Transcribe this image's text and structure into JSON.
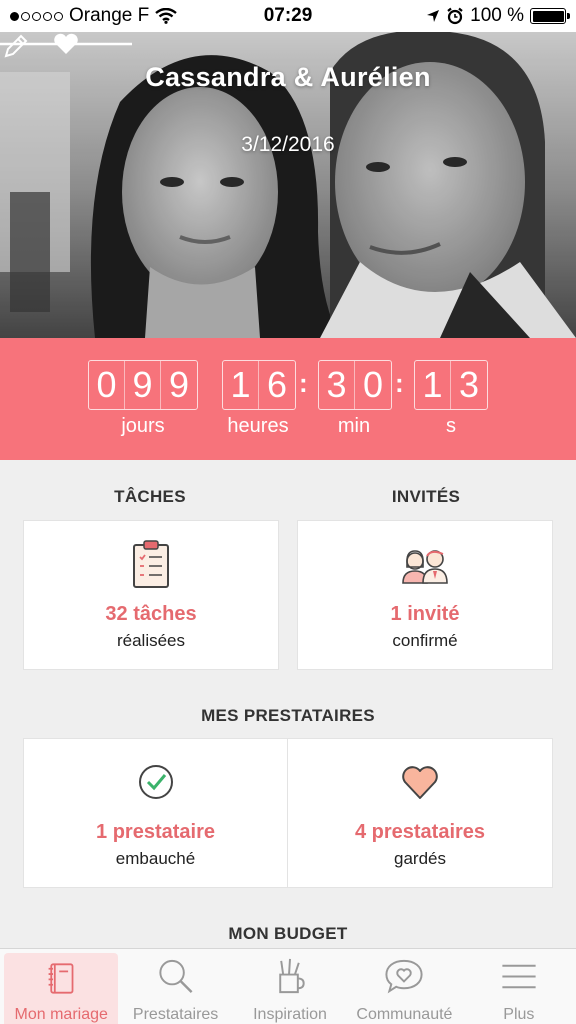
{
  "status_bar": {
    "carrier": "Orange F",
    "time": "07:29",
    "battery": "100 %"
  },
  "hero": {
    "couple_name": "Cassandra & Aurélien",
    "date": "3/12/2016"
  },
  "countdown": {
    "days_digits": [
      "0",
      "9",
      "9"
    ],
    "hours_digits": [
      "1",
      "6"
    ],
    "minutes_digits": [
      "3",
      "0"
    ],
    "seconds_digits": [
      "1",
      "3"
    ],
    "labels": {
      "days": "jours",
      "hours": "heures",
      "minutes": "min",
      "seconds": "s"
    }
  },
  "tasks": {
    "title": "TÂCHES",
    "main": "32 tâches",
    "sub": "réalisées",
    "icon": "clipboard-icon"
  },
  "guests": {
    "title": "INVITÉS",
    "main": "1 invité",
    "sub": "confirmé",
    "icon": "guests-icon"
  },
  "vendors": {
    "title": "MES PRESTATAIRES",
    "hired": {
      "main": "1 prestataire",
      "sub": "embauché",
      "icon": "check-circle-icon"
    },
    "saved": {
      "main": "4 prestataires",
      "sub": "gardés",
      "icon": "heart-icon"
    }
  },
  "budget": {
    "title": "MON BUDGET"
  },
  "tab_bar": {
    "tabs": [
      {
        "label": "Mon mariage",
        "icon": "notebook-icon",
        "active": true
      },
      {
        "label": "Prestataires",
        "icon": "search-icon",
        "active": false
      },
      {
        "label": "Inspiration",
        "icon": "pencil-cup-icon",
        "active": false
      },
      {
        "label": "Communauté",
        "icon": "chat-heart-icon",
        "active": false
      },
      {
        "label": "Plus",
        "icon": "menu-icon",
        "active": false
      }
    ]
  },
  "colors": {
    "accent": "#f7737b",
    "accent_text": "#e56a6f",
    "background": "#efefef"
  }
}
